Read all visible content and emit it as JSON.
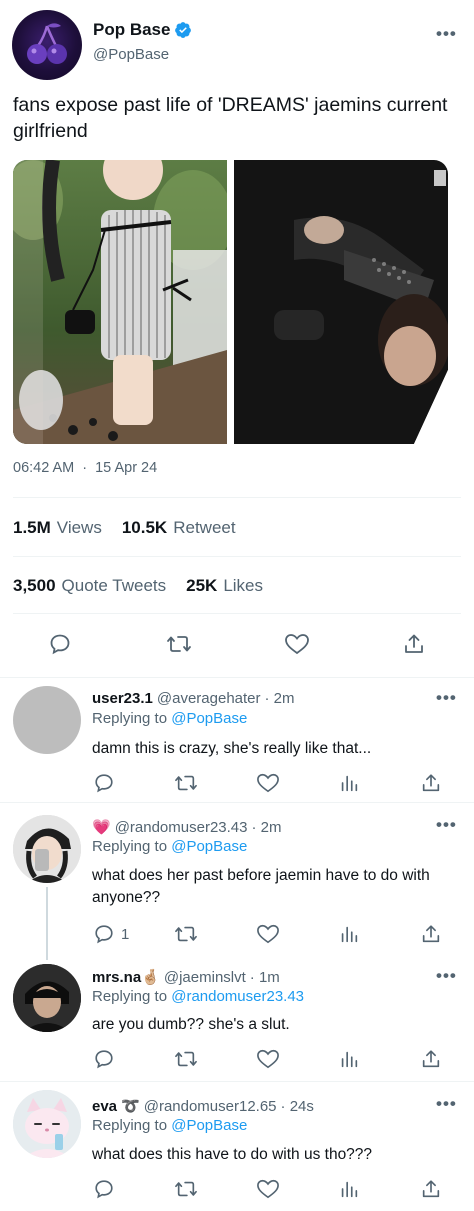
{
  "tweet": {
    "display_name": "Pop Base",
    "handle": "@PopBase",
    "text": "fans expose past life of 'DREAMS' jaemins current girlfriend",
    "time": "06:42 AM",
    "separator": "·",
    "date": "15 Apr 24",
    "views_count": "1.5M",
    "views_label": "Views",
    "retweets_count": "10.5K",
    "retweets_label": "Retweet",
    "quotes_count": "3,500",
    "quotes_label": "Quote Tweets",
    "likes_count": "25K",
    "likes_label": "Likes",
    "more": "•••"
  },
  "replies": [
    {
      "name": "user23.1",
      "handle": "@averagehater",
      "time": "· 2m",
      "replying_prefix": "Replying to",
      "replying_to": "@PopBase",
      "text": "damn this is crazy, she's really like that...",
      "reply_count": "",
      "more": "•••"
    },
    {
      "name": "💗",
      "handle": "@randomuser23.43",
      "time": "· 2m",
      "replying_prefix": "Replying to",
      "replying_to": "@PopBase",
      "text": "what does her past before jaemin have to do with anyone??",
      "reply_count": "1",
      "more": "•••"
    },
    {
      "name": "mrs.na🤞🏼",
      "handle": "@jaeminslvt",
      "time": "· 1m",
      "replying_prefix": "Replying to",
      "replying_to": "@randomuser23.43",
      "text": "are you dumb?? she's a slut.",
      "reply_count": "",
      "more": "•••"
    },
    {
      "name": "eva",
      "name_emoji": "➰",
      "handle": "@randomuser12.65",
      "time": "· 24s",
      "replying_prefix": "Replying to",
      "replying_to": "@PopBase",
      "text": "what does this have to do with us tho???",
      "reply_count": "",
      "more": "•••"
    }
  ],
  "icons": {
    "reply": "speech-bubble-icon",
    "retweet": "retweet-icon",
    "like": "heart-icon",
    "share": "share-icon",
    "analytics": "bar-chart-icon",
    "verified": "verified-badge-icon"
  },
  "colors": {
    "link": "#1d9bf0",
    "secondary_text": "#536471",
    "primary_text": "#0f1419",
    "verified": "#1d9bf0"
  }
}
